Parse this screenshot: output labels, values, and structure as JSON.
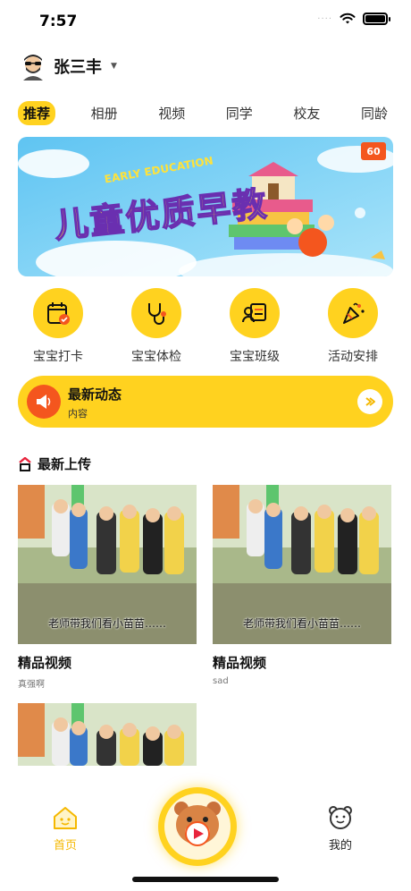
{
  "status_bar": {
    "time": "7:57",
    "dots": "····"
  },
  "user": {
    "name": "张三丰"
  },
  "tabs": [
    "推荐",
    "相册",
    "视频",
    "同学",
    "校友",
    "同龄"
  ],
  "banner": {
    "logo_text": "EARLY EDUCATION",
    "headline": "儿童优质早教",
    "badge": "60"
  },
  "quick_actions": [
    {
      "label": "宝宝打卡",
      "icon": "calendar-check-icon"
    },
    {
      "label": "宝宝体检",
      "icon": "stethoscope-icon"
    },
    {
      "label": "宝宝班级",
      "icon": "class-board-icon"
    },
    {
      "label": "活动安排",
      "icon": "party-popper-icon"
    }
  ],
  "news": {
    "title": "最新动态",
    "subtitle": "内容"
  },
  "latest": {
    "title": "最新上传",
    "videos": [
      {
        "title": "精品视频",
        "desc": "真强啊",
        "caption": "老师带我们看小苗苗……"
      },
      {
        "title": "精品视频",
        "desc": "sad",
        "caption": "老师带我们看小苗苗……"
      },
      {
        "title": "",
        "desc": "",
        "caption": ""
      }
    ]
  },
  "tab_bar": {
    "home": "首页",
    "mine": "我的"
  },
  "colors": {
    "accent": "#FFD21F",
    "alert": "#F4561E"
  }
}
